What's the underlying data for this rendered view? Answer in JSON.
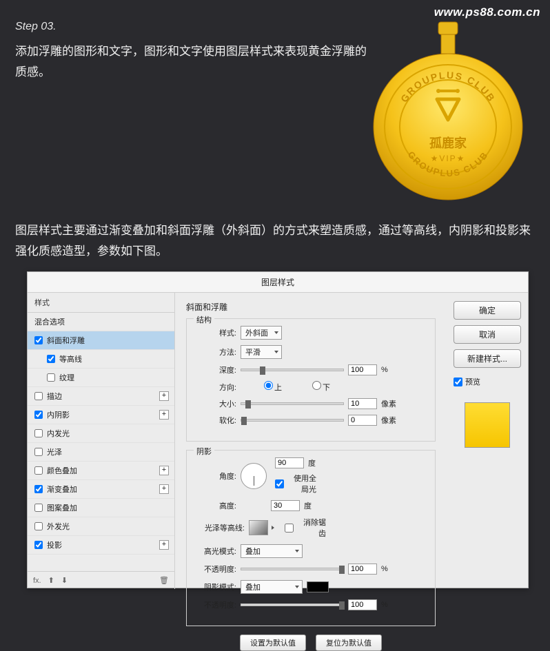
{
  "watermark": "www.ps88.com.cn",
  "step_label": "Step 03.",
  "step_desc": "添加浮雕的图形和文字，图形和文字使用图层样式来表现黄金浮雕的质感。",
  "medal": {
    "top_text": "GROUPLUS CLUB",
    "bottom_text": "GROUPLUS CLUB",
    "center_text": "孤鹿家",
    "vip": "★VIP★"
  },
  "paragraph": "图层样式主要通过渐变叠加和斜面浮雕（外斜面）的方式来塑造质感，通过等高线，内阴影和投影来强化质感造型，参数如下图。",
  "dialog": {
    "title": "图层样式",
    "left": {
      "style_header": "样式",
      "blend_options": "混合选项",
      "items": [
        {
          "label": "斜面和浮雕",
          "checked": true,
          "selected": true,
          "plus": false
        },
        {
          "label": "等高线",
          "checked": true,
          "sub": true
        },
        {
          "label": "纹理",
          "checked": false,
          "sub": true
        },
        {
          "label": "描边",
          "checked": false,
          "plus": true
        },
        {
          "label": "内阴影",
          "checked": true,
          "plus": true
        },
        {
          "label": "内发光",
          "checked": false
        },
        {
          "label": "光泽",
          "checked": false
        },
        {
          "label": "颜色叠加",
          "checked": false,
          "plus": true
        },
        {
          "label": "渐变叠加",
          "checked": true,
          "plus": true
        },
        {
          "label": "图案叠加",
          "checked": false
        },
        {
          "label": "外发光",
          "checked": false
        },
        {
          "label": "投影",
          "checked": true,
          "plus": true
        }
      ],
      "footer_fx": "fx.",
      "footer_trash": "🗑"
    },
    "center": {
      "title": "斜面和浮雕",
      "structure": {
        "legend": "结构",
        "style_label": "样式:",
        "style_value": "外斜面",
        "method_label": "方法:",
        "method_value": "平滑",
        "depth_label": "深度:",
        "depth_value": "100",
        "depth_unit": "%",
        "direction_label": "方向:",
        "up": "上",
        "down": "下",
        "size_label": "大小:",
        "size_value": "10",
        "size_unit": "像素",
        "soften_label": "软化:",
        "soften_value": "0",
        "soften_unit": "像素"
      },
      "shadow": {
        "legend": "阴影",
        "angle_label": "角度:",
        "angle_value": "90",
        "angle_unit": "度",
        "global_light": "使用全局光",
        "altitude_label": "高度:",
        "altitude_value": "30",
        "altitude_unit": "度",
        "gloss_contour_label": "光泽等高线:",
        "antialias": "消除锯齿",
        "highlight_mode_label": "高光模式:",
        "highlight_mode_value": "叠加",
        "highlight_opacity_label": "不透明度:",
        "highlight_opacity_value": "100",
        "highlight_opacity_unit": "%",
        "shadow_mode_label": "阴影模式:",
        "shadow_mode_value": "叠加",
        "shadow_opacity_label": "不透明度:",
        "shadow_opacity_value": "100",
        "shadow_opacity_unit": "%"
      },
      "make_default": "设置为默认值",
      "reset_default": "复位为默认值"
    },
    "right": {
      "ok": "确定",
      "cancel": "取消",
      "new_style": "新建样式...",
      "preview": "预览"
    }
  }
}
